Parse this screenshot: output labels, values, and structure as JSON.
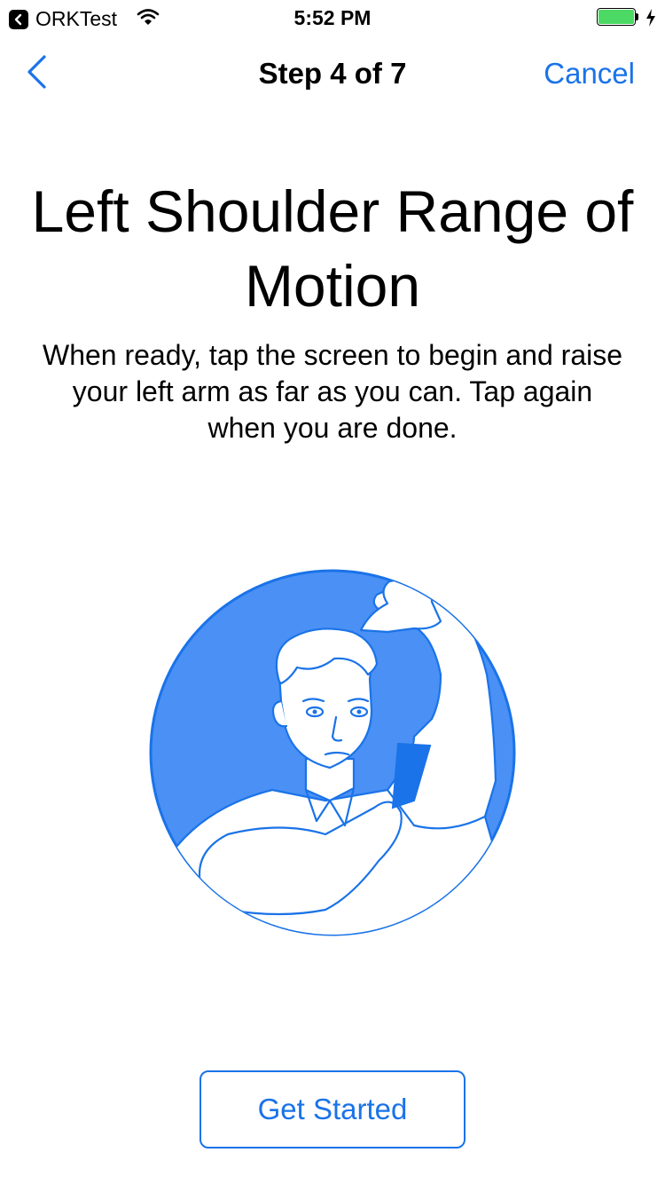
{
  "status_bar": {
    "back_app_label": "ORKTest",
    "time": "5:52 PM",
    "battery_level": 1.0,
    "icons": [
      "back-app-icon",
      "wifi-icon",
      "battery-icon",
      "charging-bolt-icon"
    ]
  },
  "nav": {
    "back_icon": "chevron-left-icon",
    "title": "Step 4 of 7",
    "cancel_label": "Cancel"
  },
  "content": {
    "title": "Left Shoulder Range of Motion",
    "instructions": "When ready, tap the screen to begin and raise your left arm as far as you can. Tap again when you are done.",
    "illustration": "shoulder-range-of-motion-illustration",
    "get_started_label": "Get Started"
  },
  "colors": {
    "accent": "#1a73e8",
    "illustration_fill": "#4a90f5",
    "battery": "#4cd964"
  }
}
